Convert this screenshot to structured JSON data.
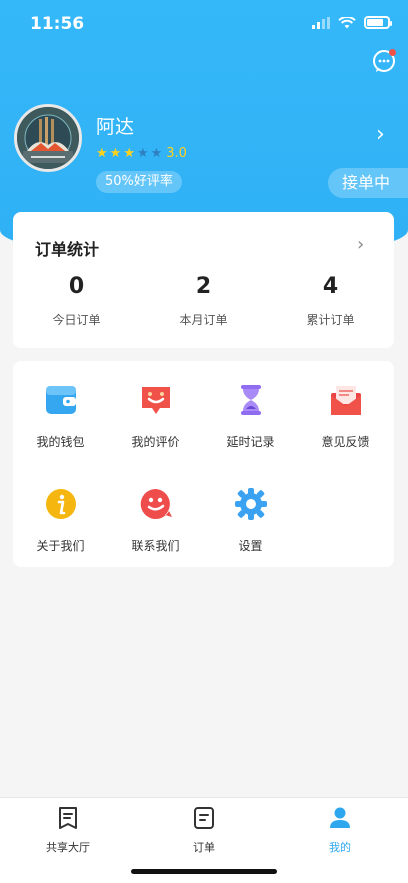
{
  "status_bar": {
    "time": "11:56"
  },
  "profile": {
    "name": "阿达",
    "rating": "3.0",
    "stars_filled": 3,
    "stars_total": 5,
    "good_rate": "50%好评率",
    "work_status": "接单中"
  },
  "stats": {
    "title": "订单统计",
    "items": [
      {
        "value": "0",
        "label": "今日订单"
      },
      {
        "value": "2",
        "label": "本月订单"
      },
      {
        "value": "4",
        "label": "累计订单"
      }
    ]
  },
  "menu": {
    "items": [
      {
        "label": "我的钱包",
        "icon": "wallet-icon"
      },
      {
        "label": "我的评价",
        "icon": "review-icon"
      },
      {
        "label": "延时记录",
        "icon": "hourglass-icon"
      },
      {
        "label": "意见反馈",
        "icon": "feedback-mail-icon"
      },
      {
        "label": "关于我们",
        "icon": "info-icon"
      },
      {
        "label": "联系我们",
        "icon": "contact-icon"
      },
      {
        "label": "设置",
        "icon": "settings-gear-icon"
      }
    ]
  },
  "tabbar": {
    "tabs": [
      {
        "label": "共享大厅",
        "icon": "hall-icon"
      },
      {
        "label": "订单",
        "icon": "order-icon"
      },
      {
        "label": "我的",
        "icon": "user-icon",
        "active": true
      }
    ]
  },
  "colors": {
    "brand_blue": "#35b8f9",
    "active_tab": "#2fa7ee",
    "star": "#ffd21c",
    "notification_dot": "#f0524a"
  }
}
